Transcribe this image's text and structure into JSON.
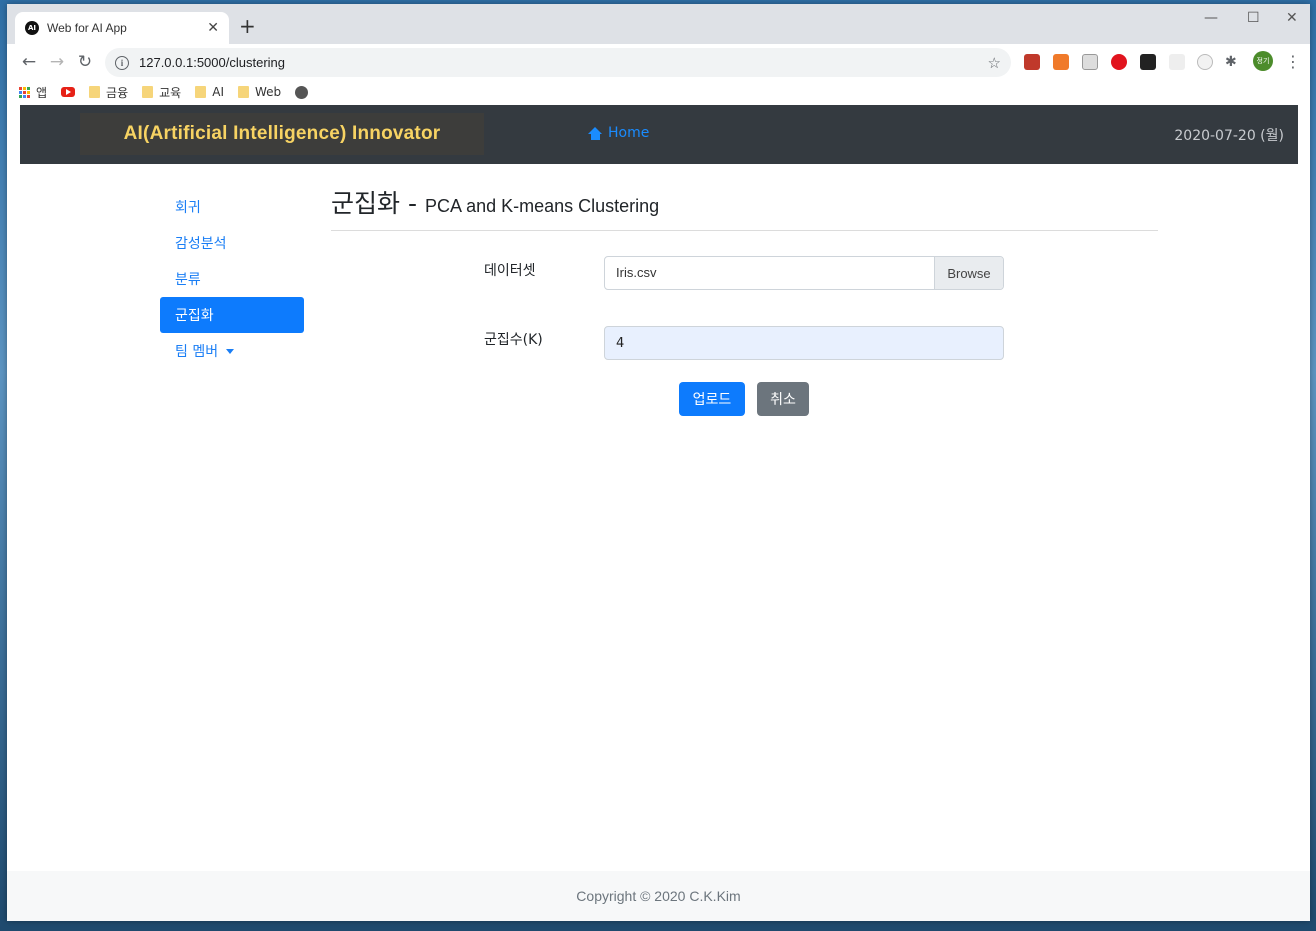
{
  "browser": {
    "tab_title": "Web for AI App",
    "tab_favicon": "AI",
    "url": "127.0.0.1:5000/clustering",
    "profile_label": "정기",
    "bookmarks": [
      {
        "icon": "apps-icon",
        "label": "앱"
      },
      {
        "icon": "youtube-icon",
        "label": ""
      },
      {
        "icon": "folder-icon",
        "label": "금융"
      },
      {
        "icon": "folder-icon",
        "label": "교육"
      },
      {
        "icon": "folder-icon",
        "label": "AI"
      },
      {
        "icon": "folder-icon",
        "label": "Web"
      },
      {
        "icon": "globe-icon",
        "label": ""
      }
    ]
  },
  "navbar": {
    "brand": "AI(Artificial Intelligence) Innovator",
    "home": "Home",
    "date": "2020-07-20 (월)"
  },
  "sidebar": {
    "items": [
      {
        "label": "회귀",
        "active": false
      },
      {
        "label": "감성분석",
        "active": false
      },
      {
        "label": "분류",
        "active": false
      },
      {
        "label": "군집화",
        "active": true
      },
      {
        "label": "팀 멤버",
        "active": false
      }
    ]
  },
  "main": {
    "title": "군집화",
    "separator": "-",
    "subtitle": "PCA and K-means Clustering",
    "dataset_label": "데이터셋",
    "dataset_value": "Iris.csv",
    "browse_label": "Browse",
    "k_label": "군집수(K)",
    "k_value": "4",
    "upload_button": "업로드",
    "cancel_button": "취소"
  },
  "footer": {
    "copyright": "Copyright © 2020 C.K.Kim"
  },
  "colors": {
    "accent": "#0d7bfd",
    "brand_text": "#f7d363",
    "navbar_bg": "#343a40"
  }
}
